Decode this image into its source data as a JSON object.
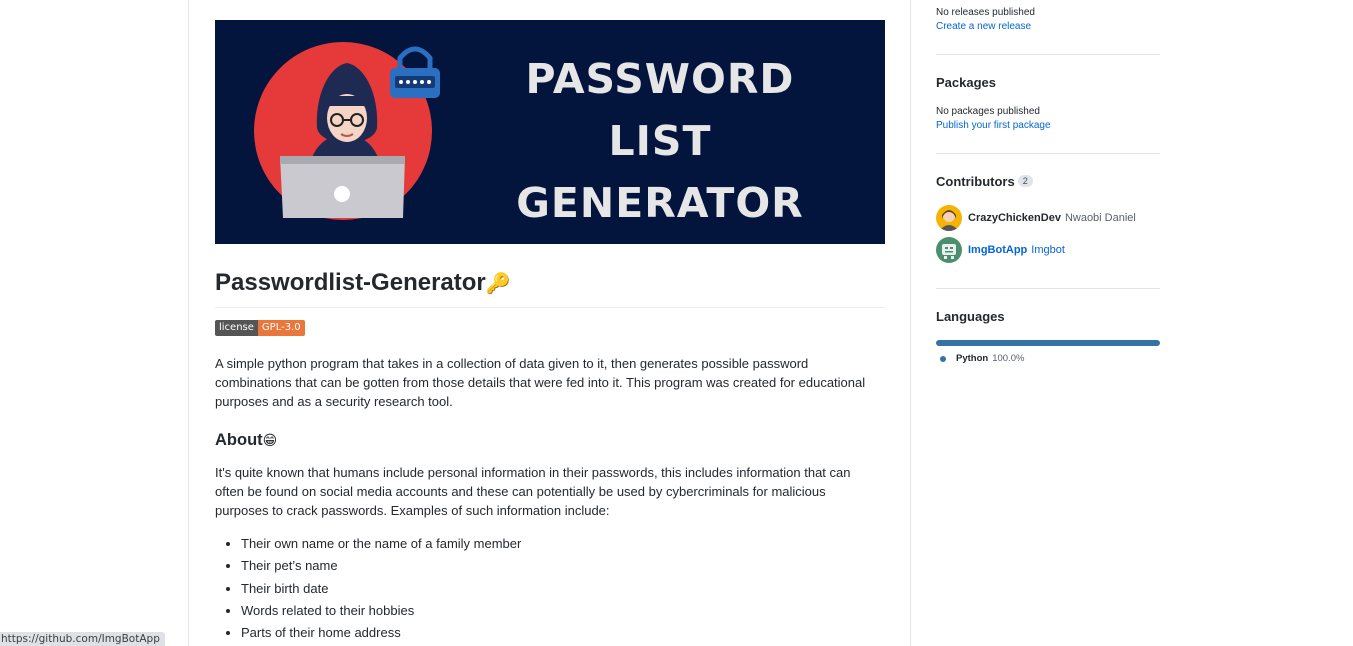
{
  "readme": {
    "banner": {
      "line1": "PASSWORD",
      "line2": "LIST",
      "line3": "GENERATOR",
      "colors": {
        "background": "#03143d",
        "circle": "#e63a3a"
      }
    },
    "title": "Passwordlist-Generator",
    "title_emoji": "🔑",
    "badge": {
      "label": "license",
      "value": "GPL-3.0"
    },
    "description": "A simple python program that takes in a collection of data given to it, then generates possible password combinations that can be gotten from those details that were fed into it. This program was created for educational purposes and as a security research tool.",
    "about_heading": "About",
    "about_emoji": "😁",
    "about_text": "It's quite known that humans include personal information in their passwords, this includes information that can often be found on social media accounts and these can potentially be used by cybercriminals for malicious purposes to crack passwords. Examples of such information include:",
    "about_items": [
      "Their own name or the name of a family member",
      "Their pet’s name",
      "Their birth date",
      "Words related to their hobbies",
      "Parts of their home address"
    ]
  },
  "sidebar": {
    "releases": {
      "status": "No releases published",
      "link": "Create a new release"
    },
    "packages": {
      "heading": "Packages",
      "status": "No packages published",
      "link": "Publish your first package"
    },
    "contributors": {
      "heading": "Contributors",
      "count": "2",
      "people": [
        {
          "login": "CrazyChickenDev",
          "name": "Nwaobi Daniel",
          "avatar_icon": "person-avatar-icon"
        },
        {
          "login": "ImgBotApp",
          "name": "Imgbot",
          "avatar_icon": "robot-avatar-icon"
        }
      ]
    },
    "languages": {
      "heading": "Languages",
      "items": [
        {
          "name": "Python",
          "percent": "100.0%",
          "share": 1.0,
          "color": "#3572a5"
        }
      ]
    }
  },
  "status_bar": {
    "url": "https://github.com/ImgBotApp"
  }
}
